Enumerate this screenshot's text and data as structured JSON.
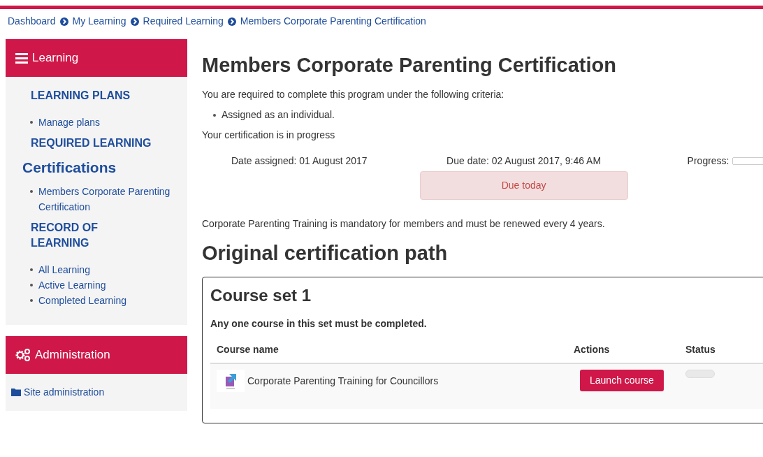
{
  "breadcrumb": [
    "Dashboard",
    "My Learning",
    "Required Learning",
    "Members Corporate Parenting Certification"
  ],
  "sidebar": {
    "learning_block": {
      "title": "Learning",
      "sections": [
        {
          "kind": "heading",
          "text": "LEARNING PLANS",
          "items": [
            "Manage plans"
          ]
        },
        {
          "kind": "heading",
          "text": "REQUIRED LEARNING"
        },
        {
          "kind": "current",
          "text": "Certifications",
          "items": [
            "Members Corporate Parenting Certification"
          ]
        },
        {
          "kind": "heading",
          "text": "RECORD OF LEARNING",
          "items": [
            "All Learning",
            "Active Learning",
            "Completed Learning"
          ]
        }
      ]
    },
    "admin_block": {
      "title": "Administration",
      "items": [
        "Site administration"
      ]
    }
  },
  "main": {
    "title": "Members Corporate Parenting Certification",
    "intro": "You are required to complete this program under the following criteria:",
    "criteria": [
      "Assigned as an individual."
    ],
    "status_text": "Your certification is in progress",
    "date_assigned": "Date assigned: 01 August 2017",
    "due_date": "Due date: 02 August 2017, 9:46 AM",
    "due_notice": "Due today",
    "progress": {
      "label": "Progress:",
      "level": 0
    },
    "description": "Corporate Parenting Training is mandatory for members and must be renewed every 4 years.",
    "path_title": "Original certification path",
    "course_set": {
      "title": "Course set 1",
      "rule": "Any one course in this set must be completed.",
      "columns": [
        "Course name",
        "Actions",
        "Status"
      ],
      "rows": [
        {
          "course": "Corporate Parenting Training for Councillors",
          "action": "Launch course",
          "status": {
            "level": 0
          }
        }
      ]
    }
  }
}
